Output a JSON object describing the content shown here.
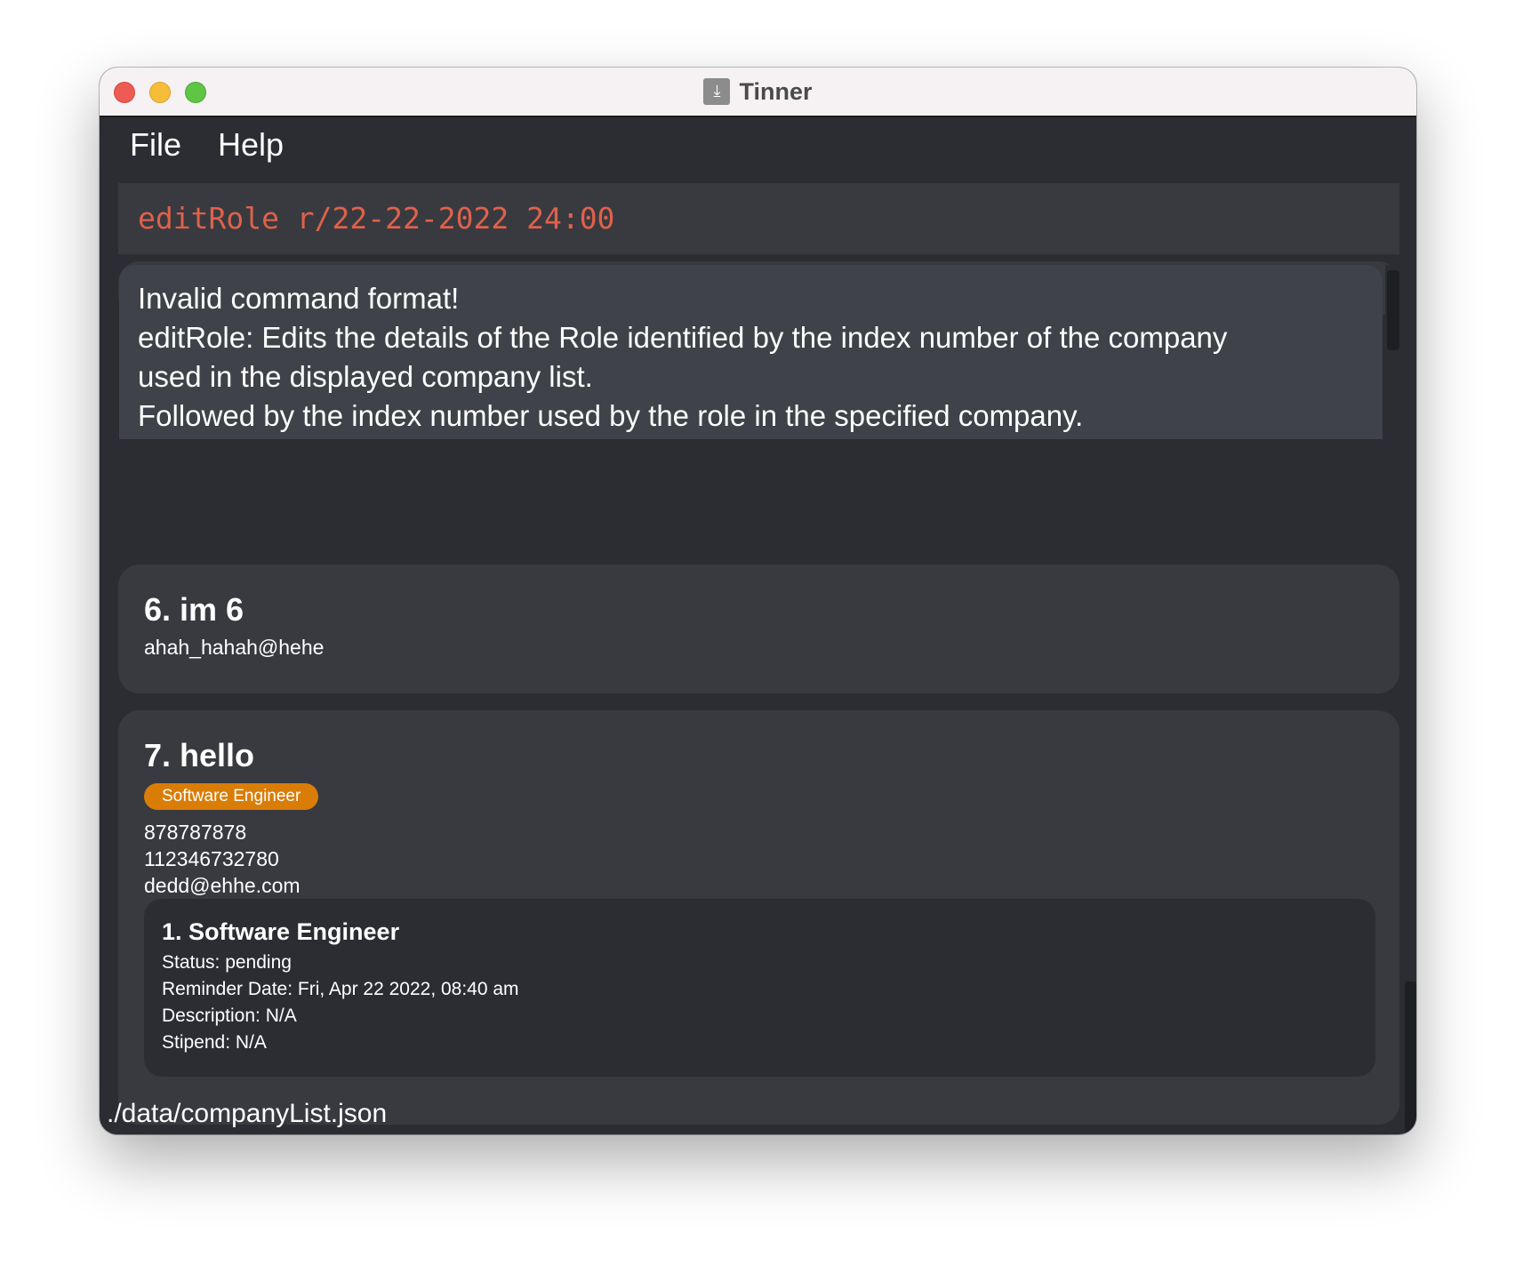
{
  "window": {
    "title": "Tinner",
    "app_icon": "download-box-icon"
  },
  "menu": {
    "file_label": "File",
    "help_label": "Help"
  },
  "command_box": {
    "value": "editRole r/22-22-2022 24:00",
    "text_color": "#e0614a"
  },
  "result_display": {
    "lines": [
      "Invalid command format!",
      "editRole: Edits the details of the Role identified by the index number of the company",
      "used in the displayed company list.",
      "Followed by the index number used by the role in the specified company."
    ]
  },
  "companies": [
    {
      "title": "6.  im 6",
      "email": "ahah_hahah@hehe"
    },
    {
      "title": "7.  hello",
      "tag": "Software Engineer",
      "phone": "878787878",
      "address": "112346732780",
      "email": "dedd@ehhe.com",
      "roles": [
        {
          "title": "1.  Software Engineer",
          "status": "Status: pending",
          "reminder": "Reminder Date: Fri, Apr 22 2022, 08:40 am",
          "description": "Description: N/A",
          "stipend": "Stipend: N/A"
        }
      ]
    }
  ],
  "status_bar": {
    "path": "./data/companyList.json"
  },
  "colors": {
    "background": "#2b2d33",
    "card": "#383a40",
    "tag": "#d97d06",
    "result_box": "#3f4249"
  }
}
